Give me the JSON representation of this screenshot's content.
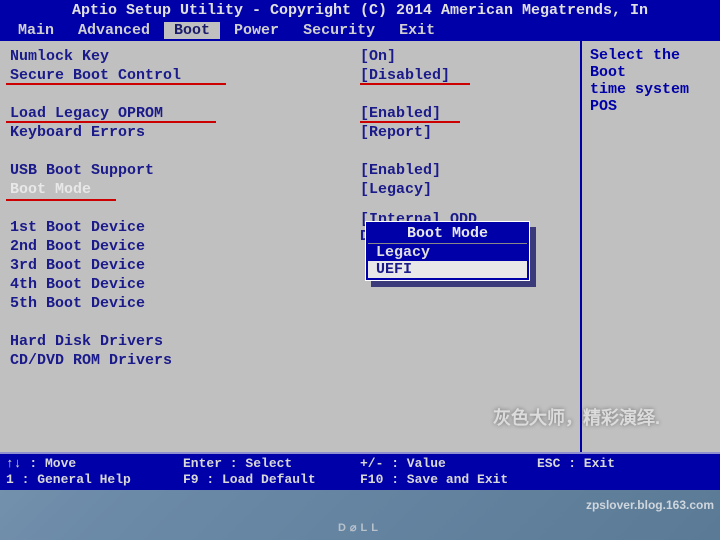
{
  "title": "Aptio Setup Utility - Copyright (C) 2014 American Megatrends, In",
  "menu": [
    "Main",
    "Advanced",
    "Boot",
    "Power",
    "Security",
    "Exit"
  ],
  "active_menu": 2,
  "settings": [
    {
      "label": "Numlock Key",
      "value": "[On]",
      "hl": false
    },
    {
      "label": "Secure Boot Control",
      "value": "[Disabled]",
      "hl": false
    },
    {
      "label": "",
      "value": "",
      "hl": false
    },
    {
      "label": "Load Legacy OPROM",
      "value": "[Enabled]",
      "hl": false
    },
    {
      "label": "Keyboard Errors",
      "value": "[Report]",
      "hl": false
    },
    {
      "label": "",
      "value": "",
      "hl": false
    },
    {
      "label": "USB Boot Support",
      "value": "[Enabled]",
      "hl": false
    },
    {
      "label": "Boot Mode",
      "value": "[Legacy]",
      "hl": true
    },
    {
      "label": "",
      "value": "",
      "hl": false
    },
    {
      "label": "1st Boot Device",
      "value": "[Internal ODD Device...]",
      "hl": false
    },
    {
      "label": "2nd Boot Device",
      "value": "",
      "hl": false
    },
    {
      "label": "3rd Boot Device",
      "value": "",
      "hl": false
    },
    {
      "label": "4th Boot Device",
      "value": "",
      "hl": false
    },
    {
      "label": "5th Boot Device",
      "value": "",
      "hl": false
    },
    {
      "label": "",
      "value": "",
      "hl": false
    },
    {
      "label": "Hard Disk Drivers",
      "value": "",
      "hl": false
    },
    {
      "label": "CD/DVD ROM Drivers",
      "value": "",
      "hl": false
    }
  ],
  "popup": {
    "title": "Boot Mode",
    "options": [
      "Legacy",
      "UEFI"
    ],
    "selected": 1
  },
  "help": {
    "line1": "Select the Boot",
    "line2": "time system POS"
  },
  "footer": {
    "r1c1": "↑↓ : Move",
    "r1c2": "Enter : Select",
    "r1c3": "+/- : Value",
    "r1c4": "ESC : Exit",
    "r2c1": "1 : General Help",
    "r2c2": "F9 : Load Default",
    "r2c3": "F10 : Save and Exit",
    "r2c4": ""
  },
  "watermark_cn": "灰色大师，精彩演绎.",
  "watermark_url": "zpslover.blog.163.com",
  "hw_logo": "D⌀LL"
}
